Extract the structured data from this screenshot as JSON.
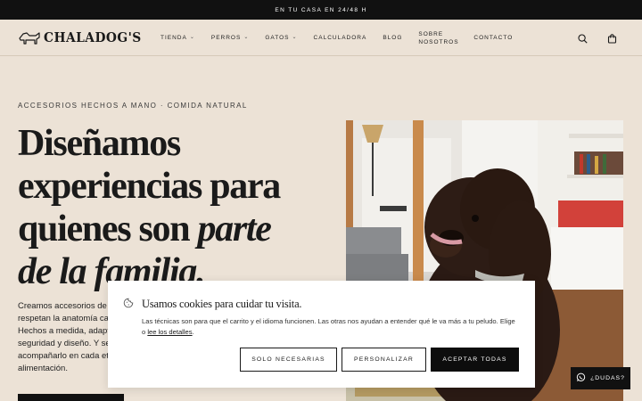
{
  "topbar": {
    "text": "EN TU CASA EN 24/48 H"
  },
  "header": {
    "logo_text": "CHALADOG'S",
    "nav": [
      {
        "label": "TIENDA",
        "dropdown": true
      },
      {
        "label": "PERROS",
        "dropdown": true
      },
      {
        "label": "GATOS",
        "dropdown": true
      },
      {
        "label": "CALCULADORA",
        "dropdown": false
      },
      {
        "label": "BLOG",
        "dropdown": false
      },
      {
        "label_line1": "SOBRE",
        "label_line2": "NOSOTROS",
        "dropdown": false
      },
      {
        "label": "CONTACTO",
        "dropdown": false
      }
    ],
    "icons": [
      "search-icon",
      "cart-icon"
    ]
  },
  "hero": {
    "eyebrow": "ACCESORIOS HECHOS A MANO · COMIDA NATURAL",
    "headline_line1": "Diseñamos",
    "headline_line2": "experiencias para",
    "headline_line3_a": "quienes son ",
    "headline_line3_b": "parte",
    "headline_line4": "de la familia.",
    "intro_lines": [
      "Creamos accesorios de p",
      "respetan la anatomía can",
      "Hechos a medida, adapta",
      "seguridad y diseño. Y sel",
      "acompañarlo en cada eta",
      "alimentación."
    ]
  },
  "cookie_banner": {
    "title": "Usamos cookies para cuidar tu visita.",
    "text_before_link": "Las técnicas son para que el carrito y el idioma funcionen. Las otras nos ayudan a entender qué le va más a tu peludo. Elige o ",
    "link_text": "lee los detalles",
    "text_after_link": ".",
    "buttons": {
      "necessary": "SOLO NECESARIAS",
      "customize": "PERSONALIZAR",
      "accept_all": "ACEPTAR TODAS"
    }
  },
  "help_button": {
    "label": "¿DUDAS?",
    "icon": "whatsapp-icon"
  },
  "colors": {
    "background": "#ece2d6",
    "topbar": "#111111",
    "button_dark": "#0d0d0d"
  }
}
